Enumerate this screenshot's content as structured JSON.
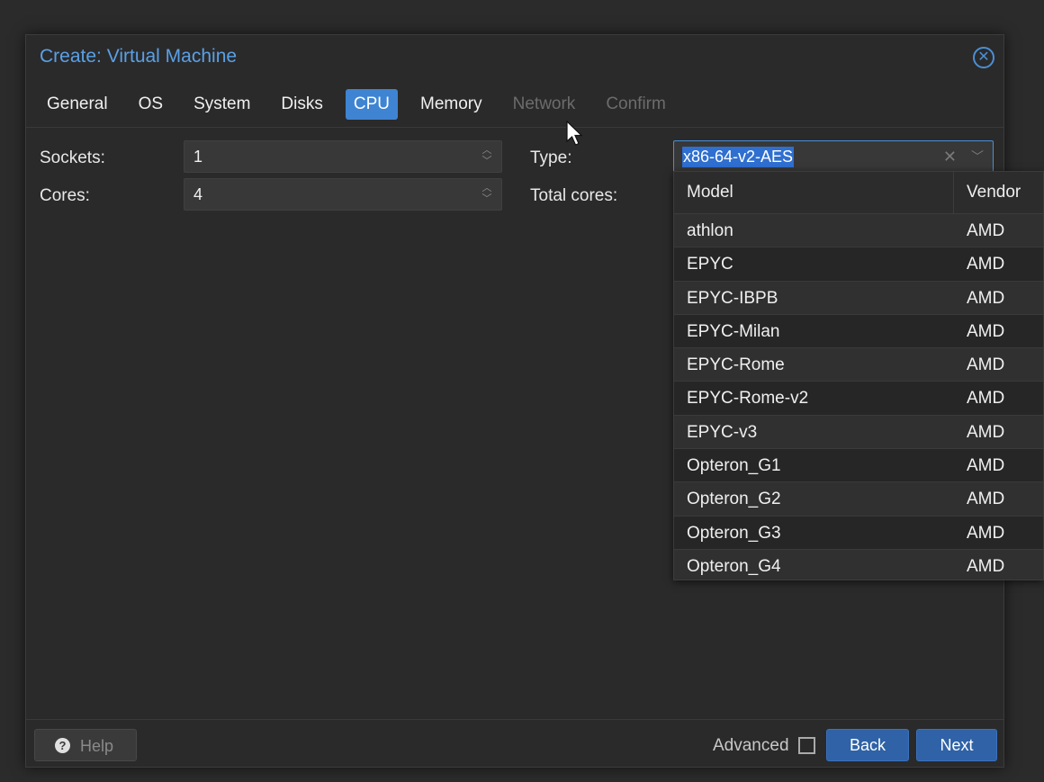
{
  "dialog": {
    "title": "Create: Virtual Machine",
    "close_icon": "close-circle-icon"
  },
  "tabs": [
    {
      "label": "General",
      "state": "normal"
    },
    {
      "label": "OS",
      "state": "normal"
    },
    {
      "label": "System",
      "state": "normal"
    },
    {
      "label": "Disks",
      "state": "normal"
    },
    {
      "label": "CPU",
      "state": "active"
    },
    {
      "label": "Memory",
      "state": "normal"
    },
    {
      "label": "Network",
      "state": "disabled"
    },
    {
      "label": "Confirm",
      "state": "disabled"
    }
  ],
  "form": {
    "sockets_label": "Sockets:",
    "sockets_value": "1",
    "cores_label": "Cores:",
    "cores_value": "4",
    "type_label": "Type:",
    "type_value": "x86-64-v2-AES",
    "total_cores_label": "Total cores:"
  },
  "cpu_dropdown": {
    "headers": {
      "model": "Model",
      "vendor": "Vendor"
    },
    "rows": [
      {
        "model": "athlon",
        "vendor": "AMD"
      },
      {
        "model": "EPYC",
        "vendor": "AMD"
      },
      {
        "model": "EPYC-IBPB",
        "vendor": "AMD"
      },
      {
        "model": "EPYC-Milan",
        "vendor": "AMD"
      },
      {
        "model": "EPYC-Rome",
        "vendor": "AMD"
      },
      {
        "model": "EPYC-Rome-v2",
        "vendor": "AMD"
      },
      {
        "model": "EPYC-v3",
        "vendor": "AMD"
      },
      {
        "model": "Opteron_G1",
        "vendor": "AMD"
      },
      {
        "model": "Opteron_G2",
        "vendor": "AMD"
      },
      {
        "model": "Opteron_G3",
        "vendor": "AMD"
      },
      {
        "model": "Opteron_G4",
        "vendor": "AMD"
      }
    ]
  },
  "footer": {
    "help_label": "Help",
    "advanced_label": "Advanced",
    "back_label": "Back",
    "next_label": "Next"
  },
  "colors": {
    "accent": "#3f84d2",
    "title": "#5aa0e6",
    "button": "#2f62a6",
    "background": "#2a2a2a"
  }
}
